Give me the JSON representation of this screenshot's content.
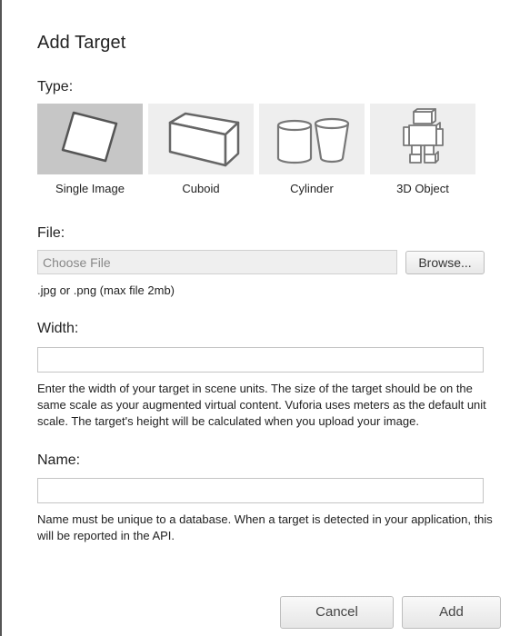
{
  "dialog": {
    "title": "Add Target"
  },
  "type_section": {
    "label": "Type:",
    "options": [
      {
        "label": "Single Image",
        "icon": "single-image-icon",
        "selected": true
      },
      {
        "label": "Cuboid",
        "icon": "cuboid-icon",
        "selected": false
      },
      {
        "label": "Cylinder",
        "icon": "cylinder-icon",
        "selected": false
      },
      {
        "label": "3D Object",
        "icon": "3d-object-icon",
        "selected": false
      }
    ]
  },
  "file_section": {
    "label": "File:",
    "placeholder": "Choose File",
    "browse_label": "Browse...",
    "hint": ".jpg or .png (max file 2mb)"
  },
  "width_section": {
    "label": "Width:",
    "value": "",
    "hint": "Enter the width of your target in scene units. The size of the target should be on the same scale as your augmented virtual content. Vuforia uses meters as the default unit scale. The target's height will be calculated when you upload your image."
  },
  "name_section": {
    "label": "Name:",
    "value": "",
    "hint": "Name must be unique to a database. When a target is detected in your application, this will be reported in the API."
  },
  "footer": {
    "cancel_label": "Cancel",
    "add_label": "Add"
  },
  "colors": {
    "selected_tile": "#c6c6c6",
    "tile": "#eeeeee"
  }
}
